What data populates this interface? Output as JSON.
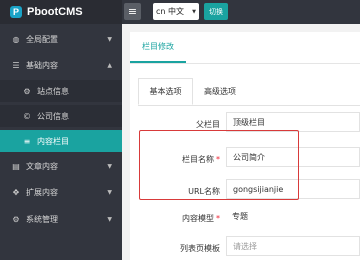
{
  "app": {
    "logo_letter": "P",
    "title": "PbootCMS"
  },
  "topbar": {
    "lang_value": "cn 中文",
    "switch_label": "切换"
  },
  "sidebar": {
    "items": [
      {
        "label": "全局配置",
        "arrow": "▼"
      },
      {
        "label": "基础内容",
        "arrow": "▲"
      },
      {
        "label": "站点信息"
      },
      {
        "label": "公司信息"
      },
      {
        "label": "内容栏目"
      },
      {
        "label": "文章内容",
        "arrow": "▼"
      },
      {
        "label": "扩展内容",
        "arrow": "▼"
      },
      {
        "label": "系统管理",
        "arrow": "▼"
      }
    ]
  },
  "main": {
    "tab_label": "栏目修改",
    "subtabs": [
      "基本选项",
      "高级选项"
    ],
    "form": {
      "parent": {
        "label": "父栏目",
        "value": "顶级栏目"
      },
      "name": {
        "label": "栏目名称",
        "required": "*",
        "value": "公司简介"
      },
      "url": {
        "label": "URL名称",
        "value": "gongsijianjie"
      },
      "model": {
        "label": "内容模型",
        "required": "*",
        "value": "专题"
      },
      "list_tpl": {
        "label": "列表页模板",
        "placeholder": "请选择"
      }
    }
  }
}
